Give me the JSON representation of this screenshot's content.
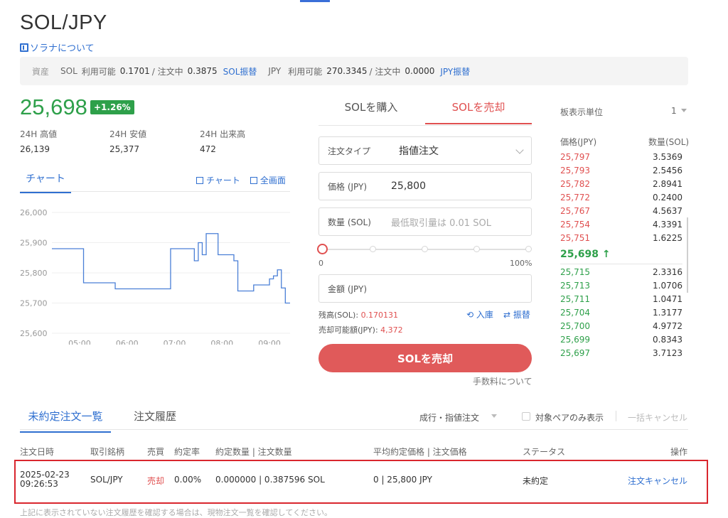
{
  "header": {
    "pair_title": "SOL/JPY",
    "about_link": "ソラナについて"
  },
  "assets": {
    "label": "資産",
    "sol_name": "SOL",
    "sol_available_label": "利用可能",
    "sol_available": "0.1701",
    "sol_ordering_label": "/ 注文中",
    "sol_ordering": "0.3875",
    "sol_transfer": "SOL振替",
    "jpy_name": "JPY",
    "jpy_available_label": "利用可能",
    "jpy_available": "270.3345",
    "jpy_ordering_label": "/ 注文中",
    "jpy_ordering": "0.0000",
    "jpy_transfer": "JPY振替"
  },
  "ticker": {
    "price": "25,698",
    "change": "+1.26%",
    "high_label": "24H 高値",
    "high": "26,139",
    "low_label": "24H 安値",
    "low": "25,377",
    "volume_label": "24H 出来高",
    "volume": "472"
  },
  "chart_panel": {
    "tab": "チャート",
    "chart_link": "チャート",
    "fullscreen_link": "全画面"
  },
  "chart_data": {
    "type": "line",
    "x": [
      "04:25",
      "04:35",
      "04:45",
      "04:55",
      "05:05",
      "05:15",
      "05:25",
      "05:35",
      "05:45",
      "05:55",
      "06:05",
      "06:15",
      "06:25",
      "06:35",
      "06:45",
      "06:55",
      "07:05",
      "07:10",
      "07:15",
      "07:20",
      "07:25",
      "07:30",
      "07:35",
      "07:40",
      "07:45",
      "07:50",
      "07:55",
      "08:00",
      "08:05",
      "08:10",
      "08:15",
      "08:20",
      "08:25",
      "08:30",
      "08:35",
      "08:40",
      "08:45",
      "08:50",
      "08:55",
      "09:00",
      "09:05",
      "09:10",
      "09:15",
      "09:20",
      "09:25"
    ],
    "series": [
      {
        "values": [
          25880,
          25880,
          25880,
          25880,
          25767,
          25767,
          25767,
          25767,
          25747,
          25747,
          25747,
          25747,
          25747,
          25747,
          25747,
          25880,
          25880,
          25880,
          25880,
          25880,
          25840,
          25900,
          25860,
          25930,
          25930,
          25930,
          25860,
          25860,
          25860,
          25860,
          25840,
          25740,
          25740,
          25740,
          25740,
          25760,
          25760,
          25760,
          25760,
          25780,
          25790,
          25810,
          25750,
          25700,
          25700
        ]
      }
    ],
    "xticks": [
      "05:00",
      "06:00",
      "07:00",
      "08:00",
      "09:00"
    ],
    "yticks": [
      "26,000",
      "25,900",
      "25,800",
      "25,700",
      "25,600"
    ],
    "ylim": [
      25600,
      26000
    ],
    "grid": "horizontal",
    "color": "#4a7fd6"
  },
  "trade": {
    "buy_tab": "SOLを購入",
    "sell_tab": "SOLを売却",
    "order_type_label": "注文タイプ",
    "order_type_value": "指値注文",
    "price_label": "価格 (JPY)",
    "price_value": "25,800",
    "qty_label": "数量 (SOL)",
    "qty_placeholder": "最低取引量は 0.01 SOL",
    "slider_min": "0",
    "slider_max": "100%",
    "slider_value_percent": 0,
    "amount_label": "金額 (JPY)",
    "balance_label": "残高(SOL):",
    "balance_value": "0.170131",
    "sellable_label": "売却可能額(JPY):",
    "sellable_value": "4,372",
    "deposit_link": "入庫",
    "transfer_link": "振替",
    "submit": "SOLを売却",
    "fee_link": "手数料について"
  },
  "orderbook": {
    "unit_label": "板表示単位",
    "unit_value": "1",
    "price_header": "価格(JPY)",
    "qty_header": "数量(SOL)",
    "asks": [
      {
        "price": "25,797",
        "qty": "3.5369"
      },
      {
        "price": "25,793",
        "qty": "2.5456"
      },
      {
        "price": "25,782",
        "qty": "2.8941"
      },
      {
        "price": "25,772",
        "qty": "0.2400"
      },
      {
        "price": "25,767",
        "qty": "4.5637"
      },
      {
        "price": "25,754",
        "qty": "4.3391"
      },
      {
        "price": "25,751",
        "qty": "1.6225"
      }
    ],
    "last_price": "25,698 ↑",
    "bids": [
      {
        "price": "25,715",
        "qty": "2.3316"
      },
      {
        "price": "25,713",
        "qty": "1.0706"
      },
      {
        "price": "25,711",
        "qty": "1.0471"
      },
      {
        "price": "25,704",
        "qty": "1.3177"
      },
      {
        "price": "25,700",
        "qty": "4.9772"
      },
      {
        "price": "25,699",
        "qty": "0.8343"
      },
      {
        "price": "25,697",
        "qty": "3.7123"
      }
    ],
    "ask_color": "#e05050",
    "bid_color": "#2ea04a"
  },
  "orders": {
    "open_tab": "未約定注文一覧",
    "history_tab": "注文履歴",
    "filter_select": "成行・指値注文",
    "pair_only_label": "対象ペアのみ表示",
    "cancel_all": "一括キャンセル",
    "headers": {
      "date": "注文日時",
      "pair": "取引銘柄",
      "side": "売買",
      "fill_rate": "約定率",
      "qty": "約定数量 | 注文数量",
      "price": "平均約定価格 | 注文価格",
      "status": "ステータス",
      "action": "操作"
    },
    "rows": [
      {
        "date": "2025-02-23",
        "time": "09:26:53",
        "pair": "SOL/JPY",
        "side": "売却",
        "fill_rate": "0.00%",
        "qty": "0.000000 | 0.387596 SOL",
        "price": "0 | 25,800 JPY",
        "status": "未約定",
        "action": "注文キャンセル"
      }
    ],
    "footnote": "上記に表示されていない注文履歴を確認する場合は、現物注文一覧を確認してください。"
  }
}
